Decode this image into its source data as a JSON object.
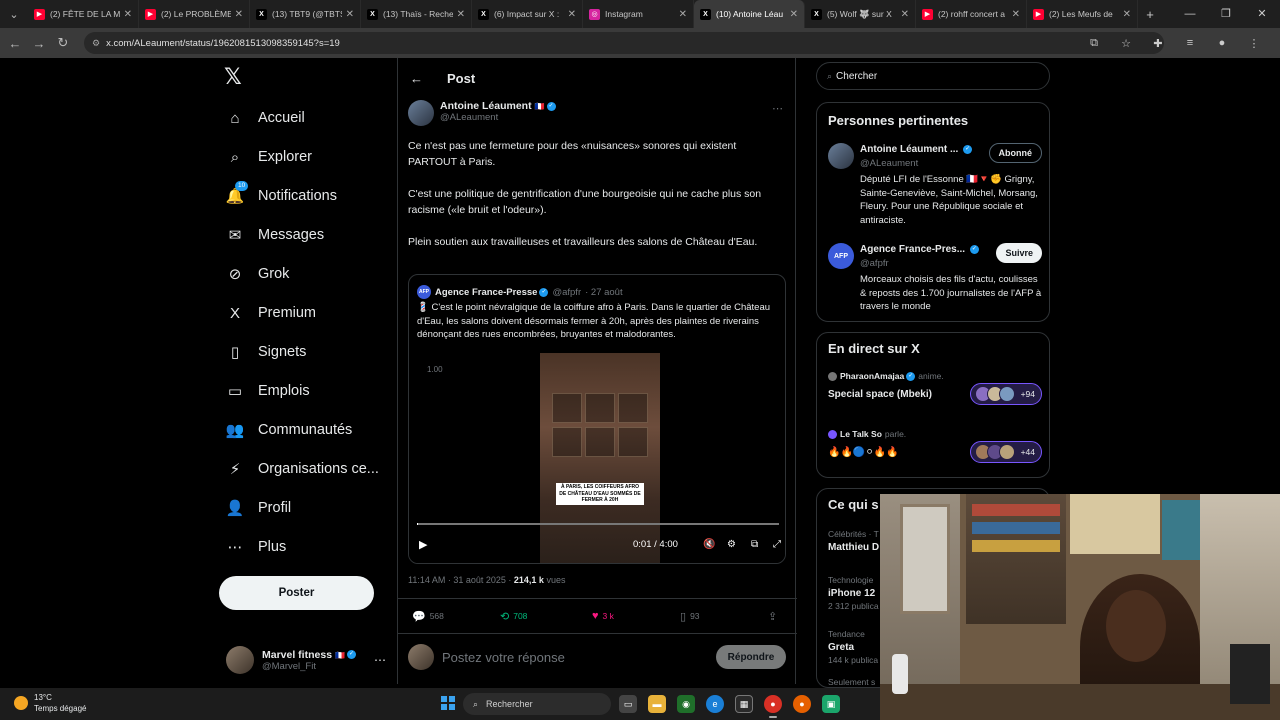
{
  "browser": {
    "tabs": [
      {
        "title": "(2) FÊTE DE LA MU",
        "color": "#ff0033",
        "glyph": "▶",
        "active": false
      },
      {
        "title": "(2) Le PROBLÈME",
        "color": "#ff0033",
        "glyph": "▶",
        "active": false
      },
      {
        "title": "(13) TBT9 (@TBTS",
        "color": "#000000",
        "glyph": "X",
        "active": false
      },
      {
        "title": "(13) Thaïs - Reche",
        "color": "#000000",
        "glyph": "X",
        "active": false
      },
      {
        "title": "(6) Impact sur X :",
        "color": "#000000",
        "glyph": "X",
        "active": false
      },
      {
        "title": "Instagram",
        "color": "#d6249f",
        "glyph": "◎",
        "active": false
      },
      {
        "title": "(10) Antoine Léau",
        "color": "#000000",
        "glyph": "X",
        "active": true
      },
      {
        "title": "(5) Wolf 🐺 sur X",
        "color": "#000000",
        "glyph": "X",
        "active": false
      },
      {
        "title": "(2) rohff concert a",
        "color": "#ff0033",
        "glyph": "▶",
        "active": false
      },
      {
        "title": "(2) Les Meufs de",
        "color": "#ff0033",
        "glyph": "▶",
        "active": false
      }
    ],
    "new_tab": "+",
    "url": "x.com/ALeaument/status/1962081513098359145?s=19"
  },
  "nav": {
    "items": [
      {
        "label": "Accueil",
        "icon": "⌂",
        "name": "home"
      },
      {
        "label": "Explorer",
        "icon": "⌕",
        "name": "explore"
      },
      {
        "label": "Notifications",
        "icon": "🔔",
        "name": "notifications",
        "badge": "10"
      },
      {
        "label": "Messages",
        "icon": "✉",
        "name": "messages"
      },
      {
        "label": "Grok",
        "icon": "⊘",
        "name": "grok"
      },
      {
        "label": "Premium",
        "icon": "X",
        "name": "premium"
      },
      {
        "label": "Signets",
        "icon": "▯",
        "name": "bookmarks"
      },
      {
        "label": "Emplois",
        "icon": "▭",
        "name": "jobs"
      },
      {
        "label": "Communautés",
        "icon": "👥",
        "name": "communities"
      },
      {
        "label": "Organisations ce...",
        "icon": "⚡",
        "name": "organizations"
      },
      {
        "label": "Profil",
        "icon": "👤",
        "name": "profile"
      },
      {
        "label": "Plus",
        "icon": "⋯",
        "name": "more"
      }
    ],
    "post_button": "Poster",
    "user": {
      "name": "Marvel fitness",
      "flag": "🇫🇷",
      "handle": "@Marvel_Fit"
    }
  },
  "post": {
    "header": "Post",
    "author": {
      "name": "Antoine Léaument",
      "flag": "🇫🇷",
      "handle": "@ALeaument"
    },
    "paragraphs": [
      "Ce n'est pas une fermeture pour des «nuisances» sonores qui existent PARTOUT à Paris.",
      "C'est une politique de gentrification d'une bourgeoisie qui ne cache plus son racisme («le bruit et l'odeur»).",
      "Plein soutien aux travailleuses et travailleurs des salons de Château d'Eau."
    ],
    "quote": {
      "avatar": "AFP",
      "name": "Agence France-Presse",
      "handle": "@afpfr",
      "date": "· 27 août",
      "text": "💈 C'est le point névralgique de la coiffure afro à Paris. Dans le quartier de Château d'Eau, les salons doivent désormais fermer à 20h, après des plaintes de riverains dénonçant des rues encombrées, bruyantes et malodorantes.",
      "video": {
        "speed": "1.00",
        "caption": "À PARIS, LES COIFFEURS AFRO DE CHÂTEAU D'EAU SOMMÉS DE FERMER À 20H",
        "time": "0:01 / 4:00",
        "progress": 0.004
      }
    },
    "timestamp": "11:14 AM · 31 août 2025 · ",
    "views_count": "214,1 k",
    "views_label": " vues",
    "actions": {
      "replies": "568",
      "reposts": "708",
      "likes": "3 k",
      "bookmarks": "93"
    },
    "reply_placeholder": "Postez votre réponse",
    "reply_button": "Répondre"
  },
  "sidebar": {
    "search_placeholder": "Chercher",
    "relevant": {
      "title": "Personnes pertinentes",
      "people": [
        {
          "name": "Antoine Léaument ...",
          "handle": "@ALeaument",
          "button": "Abonné",
          "bio": "Député LFI de l'Essonne 🇫🇷🔻✊ Grigny, Sainte-Geneviève, Saint-Michel, Morsang, Fleury. Pour une République sociale et antiraciste."
        },
        {
          "name": "Agence France-Pres...",
          "handle": "@afpfr",
          "button": "Suivre",
          "bio": "Morceaux choisis des fils d'actu, coulisses & reposts des 1.700 journalistes de l'AFP à travers le monde"
        }
      ]
    },
    "live": {
      "title": "En direct sur X",
      "spaces": [
        {
          "host": "PharaonAmajaa",
          "role": "anime.",
          "title": "Special space (Mbeki)",
          "count": "+94"
        },
        {
          "host": "Le Talk So",
          "role": "parle.",
          "title": "🔥🔥🔵⚪🔥🔥",
          "count": "+44"
        }
      ]
    },
    "trending": {
      "title": "Ce qui s",
      "items": [
        {
          "category": "Célébrités · T",
          "name": "Matthieu D",
          "count": ""
        },
        {
          "category": "Technologie",
          "name": "iPhone 12",
          "count": "2 312 publica"
        },
        {
          "category": "Tendance",
          "name": "Greta",
          "count": "144 k publica"
        },
        {
          "category": "Seulement s",
          "name": "",
          "count": ""
        }
      ]
    }
  },
  "taskbar": {
    "weather_temp": "13°C",
    "weather_desc": "Temps dégagé",
    "search_label": "Rechercher"
  }
}
